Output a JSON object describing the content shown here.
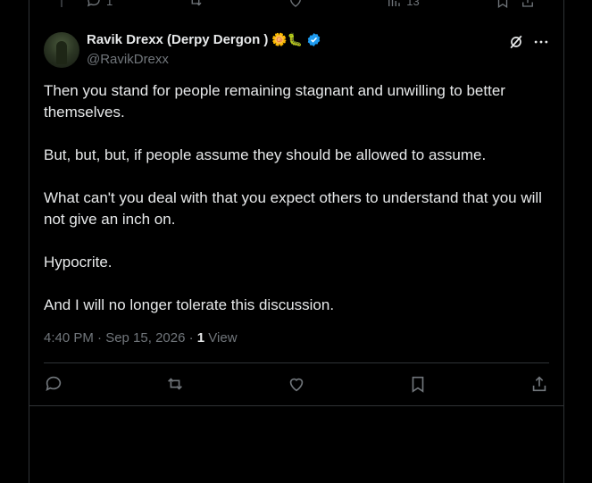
{
  "prev_tweet": {
    "reply_count": "1",
    "view_count": "13"
  },
  "author": {
    "display_name": "Ravik Drexx (Derpy Dergon )",
    "emojis": "🌼🐛",
    "handle": "@RavikDrexx",
    "verified": true
  },
  "tweet": {
    "paragraphs": [
      "Then you stand for people remaining stagnant and unwilling to better themselves.",
      "But, but, but, if people assume they should be allowed to assume.",
      "What can't you deal with that you expect others to understand that you will not give an inch on.",
      "Hypocrite.",
      "And I will no longer tolerate this discussion."
    ],
    "timestamp": "4:40 PM · Sep 15, 2026 · ",
    "views_count": "1",
    "views_label": " View"
  },
  "icons": {
    "reply": "reply-icon",
    "repost": "repost-icon",
    "like": "like-icon",
    "bookmark": "bookmark-icon",
    "share": "share-icon",
    "grok": "grok-icon",
    "more": "more-icon",
    "analytics": "analytics-icon",
    "verified": "verified-badge-icon"
  },
  "colors": {
    "background": "#000000",
    "text": "#e7e9ea",
    "muted": "#71767b",
    "border": "#2f3336",
    "verified_blue": "#1d9bf0"
  }
}
